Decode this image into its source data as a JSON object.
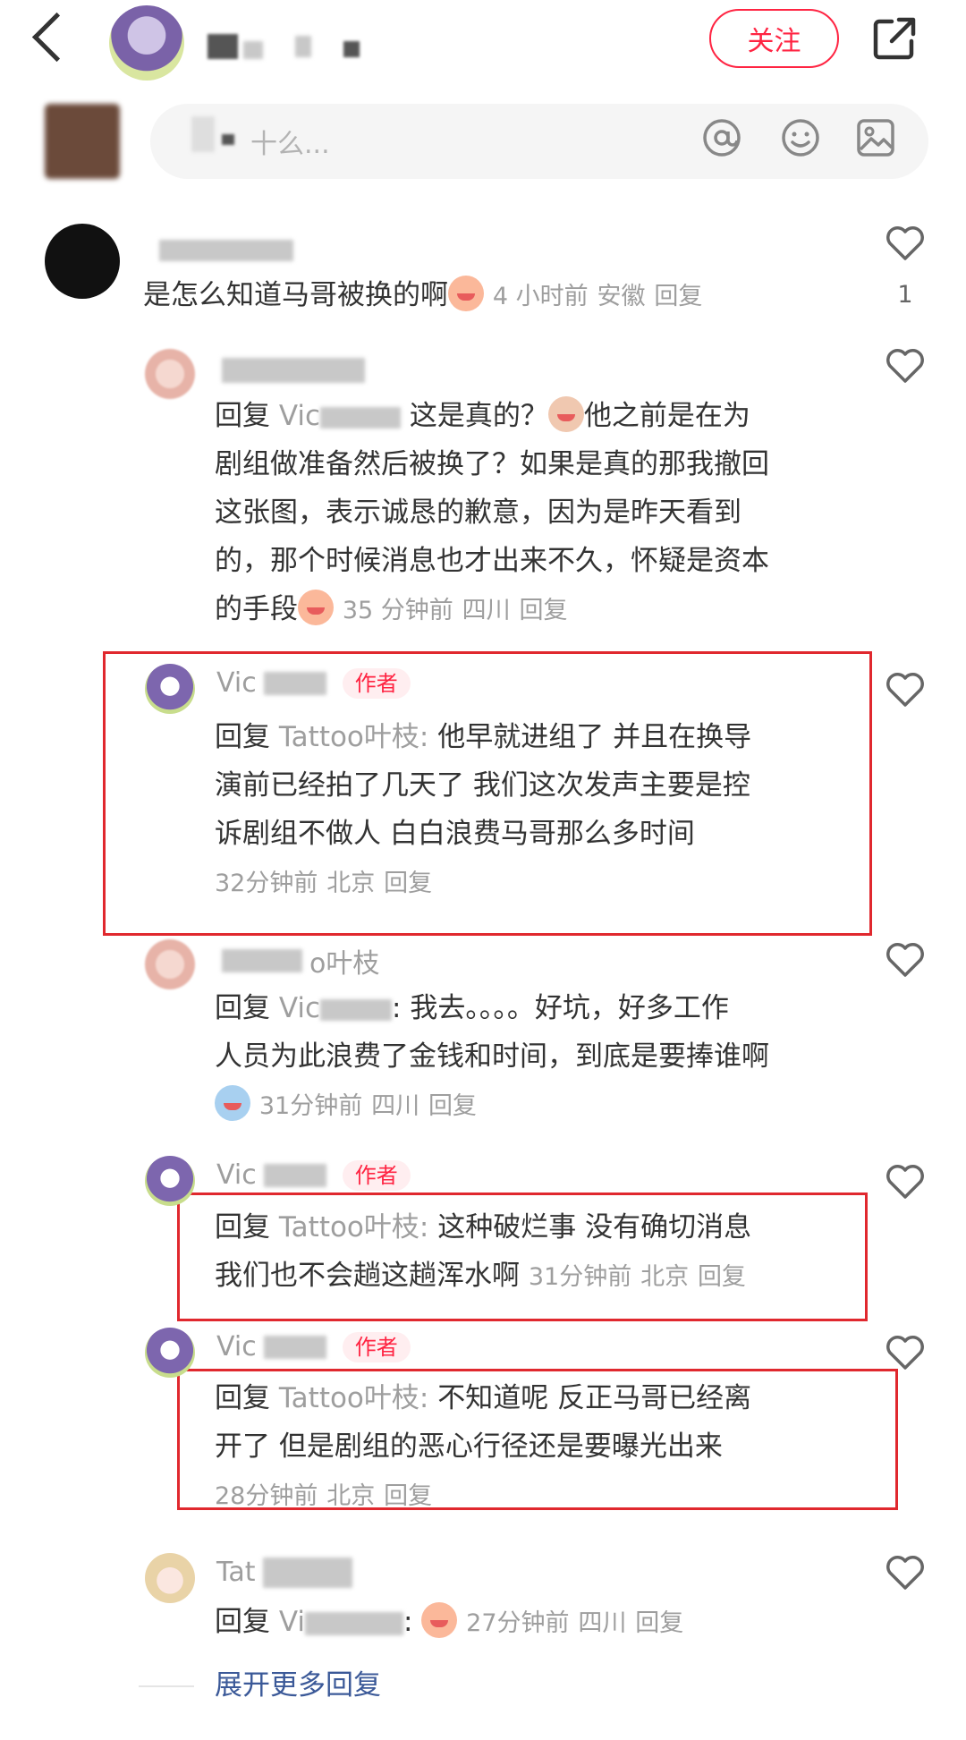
{
  "header": {
    "follow_label": "关注"
  },
  "input": {
    "placeholder": "十么..."
  },
  "comments": [
    {
      "text": "是怎么知道马哥被换的啊",
      "time": "4 小时前",
      "location": "安徽",
      "reply_label": "回复",
      "likes": "1"
    }
  ],
  "replies": [
    {
      "reply_prefix": "回复",
      "reply_to": "Vic",
      "text_line1": "这是真的？",
      "text_line1b": "他之前是在为",
      "text_line2": "剧组做准备然后被换了？如果是真的那我撤回",
      "text_line3": "这张图，表示诚恳的歉意，因为是昨天看到",
      "text_line4": "的，那个时候消息也才出来不久，怀疑是资本",
      "text_line5": "的手段",
      "time": "35 分钟前",
      "location": "四川",
      "reply_label": "回复"
    },
    {
      "username": "Vic",
      "author_tag": "作者",
      "reply_prefix": "回复",
      "reply_to": "Tattoo叶枝:",
      "text_line1": "他早就进组了  并且在换导",
      "text_line2": "演前已经拍了几天了   我们这次发声主要是控",
      "text_line3": "诉剧组不做人  白白浪费马哥那么多时间",
      "time": "32分钟前",
      "location": "北京",
      "reply_label": "回复"
    },
    {
      "username": "o叶枝",
      "reply_prefix": "回复",
      "reply_to": "Vic",
      "text_line1": ": 我去。。。。好坑，好多工作",
      "text_line2": "人员为此浪费了金钱和时间，到底是要捧谁啊",
      "time": "31分钟前",
      "location": "四川",
      "reply_label": "回复"
    },
    {
      "username": "Vic",
      "author_tag": "作者",
      "reply_prefix": "回复",
      "reply_to": "Tattoo叶枝:",
      "text_line1": "这种破烂事  没有确切消息",
      "text_line2": "我们也不会趟这趟浑水啊",
      "time": "31分钟前",
      "location": "北京",
      "reply_label": "回复"
    },
    {
      "username": "Vic",
      "author_tag": "作者",
      "reply_prefix": "回复",
      "reply_to": "Tattoo叶枝:",
      "text_line1": "不知道呢   反正马哥已经离",
      "text_line2": "开了  但是剧组的恶心行径还是要曝光出来",
      "time": "28分钟前",
      "location": "北京",
      "reply_label": "回复"
    },
    {
      "username": "Tat",
      "reply_prefix": "回复",
      "reply_to": "Vi",
      "text_line1": ":",
      "time": "27分钟前",
      "location": "四川",
      "reply_label": "回复"
    }
  ],
  "more_replies_label": "展开更多回复",
  "colors": {
    "accent": "#ff2442",
    "link": "#3b5998",
    "highlight_box": "#e0282e"
  }
}
